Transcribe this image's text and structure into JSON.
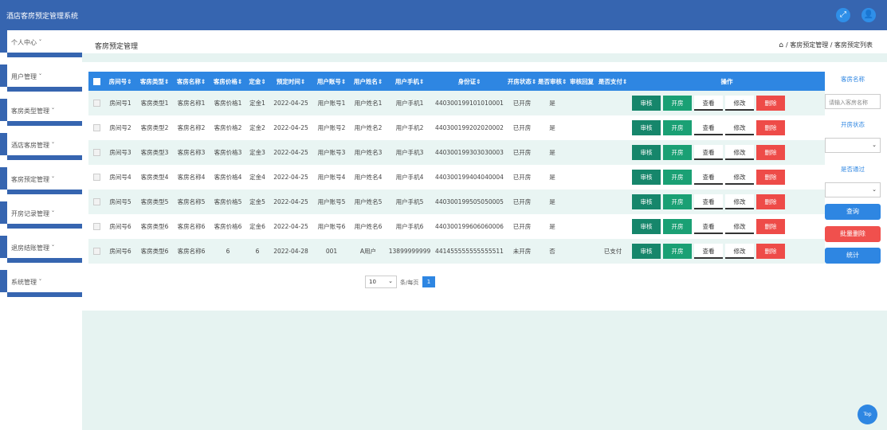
{
  "app": {
    "title": "酒店客房预定管理系统",
    "fullscreen_icon": "fullscreen-icon",
    "user_icon": "user-icon"
  },
  "sidebar": {
    "items": [
      {
        "label": "个人中心 ˇ"
      },
      {
        "label": "用户管理 ˇ"
      },
      {
        "label": "客房类型管理 ˇ"
      },
      {
        "label": "酒店客房管理 ˇ"
      },
      {
        "label": "客房预定管理 ˇ"
      },
      {
        "label": "开房记录管理 ˇ"
      },
      {
        "label": "退房结账管理 ˇ"
      },
      {
        "label": "系统管理 ˇ"
      }
    ]
  },
  "page": {
    "title": "客房预定管理",
    "breadcrumb": "/ 客房预定管理 / 客房预定列表"
  },
  "table": {
    "headers": [
      "房间号",
      "客房类型",
      "客房名称",
      "客房价格",
      "定金",
      "预定时间",
      "用户账号",
      "用户姓名",
      "用户手机",
      "身份证",
      "开房状态",
      "是否审核",
      "审核回复",
      "是否支付",
      "操作"
    ],
    "rows": [
      [
        "房间号1",
        "客房类型1",
        "客房名称1",
        "客房价格1",
        "定金1",
        "2022-04-25",
        "用户账号1",
        "用户姓名1",
        "用户手机1",
        "440300199101010001",
        "已开房",
        "是",
        "",
        ""
      ],
      [
        "房间号2",
        "客房类型2",
        "客房名称2",
        "客房价格2",
        "定金2",
        "2022-04-25",
        "用户账号2",
        "用户姓名2",
        "用户手机2",
        "440300199202020002",
        "已开房",
        "是",
        "",
        ""
      ],
      [
        "房间号3",
        "客房类型3",
        "客房名称3",
        "客房价格3",
        "定金3",
        "2022-04-25",
        "用户账号3",
        "用户姓名3",
        "用户手机3",
        "440300199303030003",
        "已开房",
        "是",
        "",
        ""
      ],
      [
        "房间号4",
        "客房类型4",
        "客房名称4",
        "客房价格4",
        "定金4",
        "2022-04-25",
        "用户账号4",
        "用户姓名4",
        "用户手机4",
        "440300199404040004",
        "已开房",
        "是",
        "",
        ""
      ],
      [
        "房间号5",
        "客房类型5",
        "客房名称5",
        "客房价格5",
        "定金5",
        "2022-04-25",
        "用户账号5",
        "用户姓名5",
        "用户手机5",
        "440300199505050005",
        "已开房",
        "是",
        "",
        ""
      ],
      [
        "房间号6",
        "客房类型6",
        "客房名称6",
        "客房价格6",
        "定金6",
        "2022-04-25",
        "用户账号6",
        "用户姓名6",
        "用户手机6",
        "440300199606060006",
        "已开房",
        "是",
        "",
        ""
      ],
      [
        "房间号6",
        "客房类型6",
        "客房名称6",
        "6",
        "6",
        "2022-04-28",
        "001",
        "A用户",
        "13899999999",
        "441455555555555511",
        "未开房",
        "否",
        "",
        "已支付"
      ]
    ],
    "actions": {
      "audit": "审核",
      "open": "开房",
      "view": "查看",
      "edit": "修改",
      "delete": "删除"
    }
  },
  "pager": {
    "page_size": "10",
    "per_page_label": "条/每页",
    "current_page": "1"
  },
  "filters": {
    "room_name_label": "客房名称",
    "room_name_placeholder": "请输入客房名称",
    "status_label": "开房状态",
    "approved_label": "是否通过",
    "search_button": "查询",
    "batch_delete_button": "批量删除",
    "stats_button": "统计"
  },
  "back_to_top": "Top",
  "colors": {
    "header_blue": "#3665b0",
    "accent_blue": "#2e86e2",
    "audit_green": "#16866b",
    "delete_red": "#ee4b48",
    "content_bg": "#e6f3f1"
  }
}
